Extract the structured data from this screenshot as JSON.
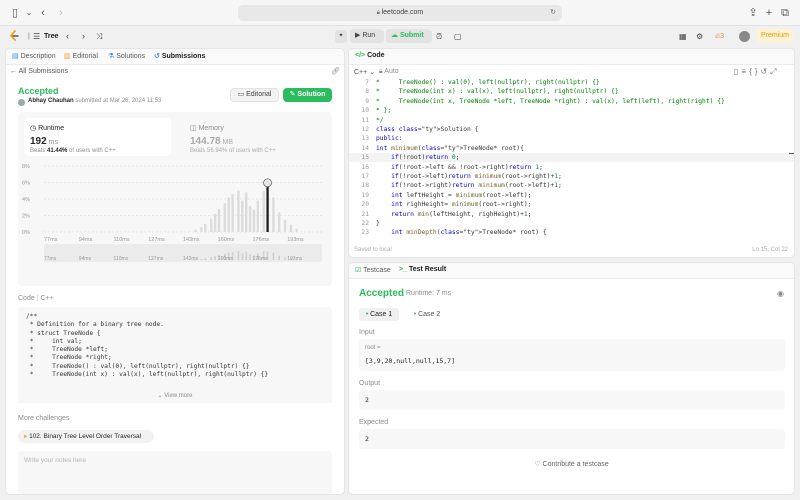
{
  "browser": {
    "url": "leetcode.com"
  },
  "nav": {
    "problem_list": "Tree",
    "run": "Run",
    "submit": "Submit",
    "streak": "3",
    "premium": "Premium"
  },
  "left_tabs": [
    "Description",
    "Editorial",
    "Solutions",
    "Submissions"
  ],
  "submission": {
    "back_label": "All Submissions",
    "status": "Accepted",
    "author": "Abhay Chauhan",
    "submitted_at": "submitted at Mar 26, 2024 11:53",
    "editorial_btn": "Editorial",
    "solution_btn": "Solution",
    "runtime_label": "Runtime",
    "runtime_value": "192",
    "runtime_unit": "ms",
    "runtime_beats_prefix": "Beats",
    "runtime_beats_pct": "41.44%",
    "runtime_beats_suffix": "of users with C++",
    "memory_label": "Memory",
    "memory_value": "144.78",
    "memory_unit": "MB",
    "memory_beats_prefix": "Beats",
    "memory_beats_pct": "56.94%",
    "memory_beats_suffix": "of users with C++"
  },
  "chart_data": {
    "type": "bar",
    "title": "",
    "ylabel": "",
    "xlabel": "",
    "yticks": [
      "8%",
      "6%",
      "4%",
      "2%",
      "0%"
    ],
    "ylim": [
      0,
      8
    ],
    "xticks": [
      "77ms",
      "94ms",
      "110ms",
      "127ms",
      "143ms",
      "160ms",
      "176ms",
      "193ms"
    ],
    "xlim": [
      77,
      220
    ],
    "highlight_x": 192,
    "x": [
      155,
      158,
      160,
      163,
      165,
      167,
      170,
      172,
      174,
      177,
      179,
      181,
      183,
      185,
      187,
      190,
      192,
      195,
      198,
      201,
      204,
      207
    ],
    "values": [
      0.3,
      0.6,
      1.0,
      1.6,
      2.2,
      2.8,
      3.5,
      4.2,
      4.6,
      5.0,
      3.8,
      4.8,
      3.2,
      2.7,
      3.8,
      5.0,
      4.8,
      4.2,
      2.4,
      1.5,
      0.9,
      0.4
    ]
  },
  "code_section": {
    "label": "Code",
    "language": "C++",
    "lines": [
      "/**",
      " * Definition for a binary tree node.",
      " * struct TreeNode {",
      " *     int val;",
      " *     TreeNode *left;",
      " *     TreeNode *right;",
      " *     TreeNode() : val(0), left(nullptr), right(nullptr) {}",
      " *     TreeNode(int x) : val(x), left(nullptr), right(nullptr) {}"
    ],
    "view_more": "View more"
  },
  "more": {
    "label": "More challenges",
    "challenge": "102. Binary Tree Level Order Traversal",
    "notes_placeholder": "Write your notes here"
  },
  "editor": {
    "tab": "Code",
    "language": "C++",
    "mode": "Auto",
    "lines": [
      {
        "n": "7",
        "t": "*     TreeNode() : val(0), left(nullptr), right(nullptr) {}"
      },
      {
        "n": "8",
        "t": "*     TreeNode(int x) : val(x), left(nullptr), right(nullptr) {}"
      },
      {
        "n": "9",
        "t": "*     TreeNode(int x, TreeNode *left, TreeNode *right) : val(x), left(left), right(right) {}"
      },
      {
        "n": "10",
        "t": "* };"
      },
      {
        "n": "11",
        "t": "*/"
      },
      {
        "n": "12",
        "t": "class Solution {"
      },
      {
        "n": "13",
        "t": "public:"
      },
      {
        "n": "14",
        "t": "int minimum(TreeNode* root){"
      },
      {
        "n": "15",
        "t": "    if(!root)return 0;"
      },
      {
        "n": "16",
        "t": "    if(!root->left && !root->right)return 1;"
      },
      {
        "n": "17",
        "t": "    if(!root->left)return minimum(root->right)+1;"
      },
      {
        "n": "18",
        "t": "    if(!root->right)return minimum(root->left)+1;"
      },
      {
        "n": "19",
        "t": "    int leftHeight = minimum(root->left);"
      },
      {
        "n": "20",
        "t": "    int righHeight= minimum(root->right);"
      },
      {
        "n": "21",
        "t": "    return min(leftHeight, righHeight)+1;"
      },
      {
        "n": "22",
        "t": "}"
      },
      {
        "n": "23",
        "t": "    int minDepth(TreeNode* root) {"
      }
    ],
    "saved": "Saved to local",
    "cursor": "Ln 15, Col 22"
  },
  "testpanel": {
    "tab_testcase": "Testcase",
    "tab_result": "Test Result",
    "status": "Accepted",
    "runtime": "Runtime: 7 ms",
    "case1": "Case 1",
    "case2": "Case 2",
    "input_label": "Input",
    "input_name": "root =",
    "input_value": "[3,9,20,null,null,15,7]",
    "output_label": "Output",
    "output_value": "2",
    "expected_label": "Expected",
    "expected_value": "2",
    "contribute": "Contribute a testcase"
  },
  "colors": {
    "accent_green": "#2cbb5d",
    "premium": "#d4a200"
  }
}
